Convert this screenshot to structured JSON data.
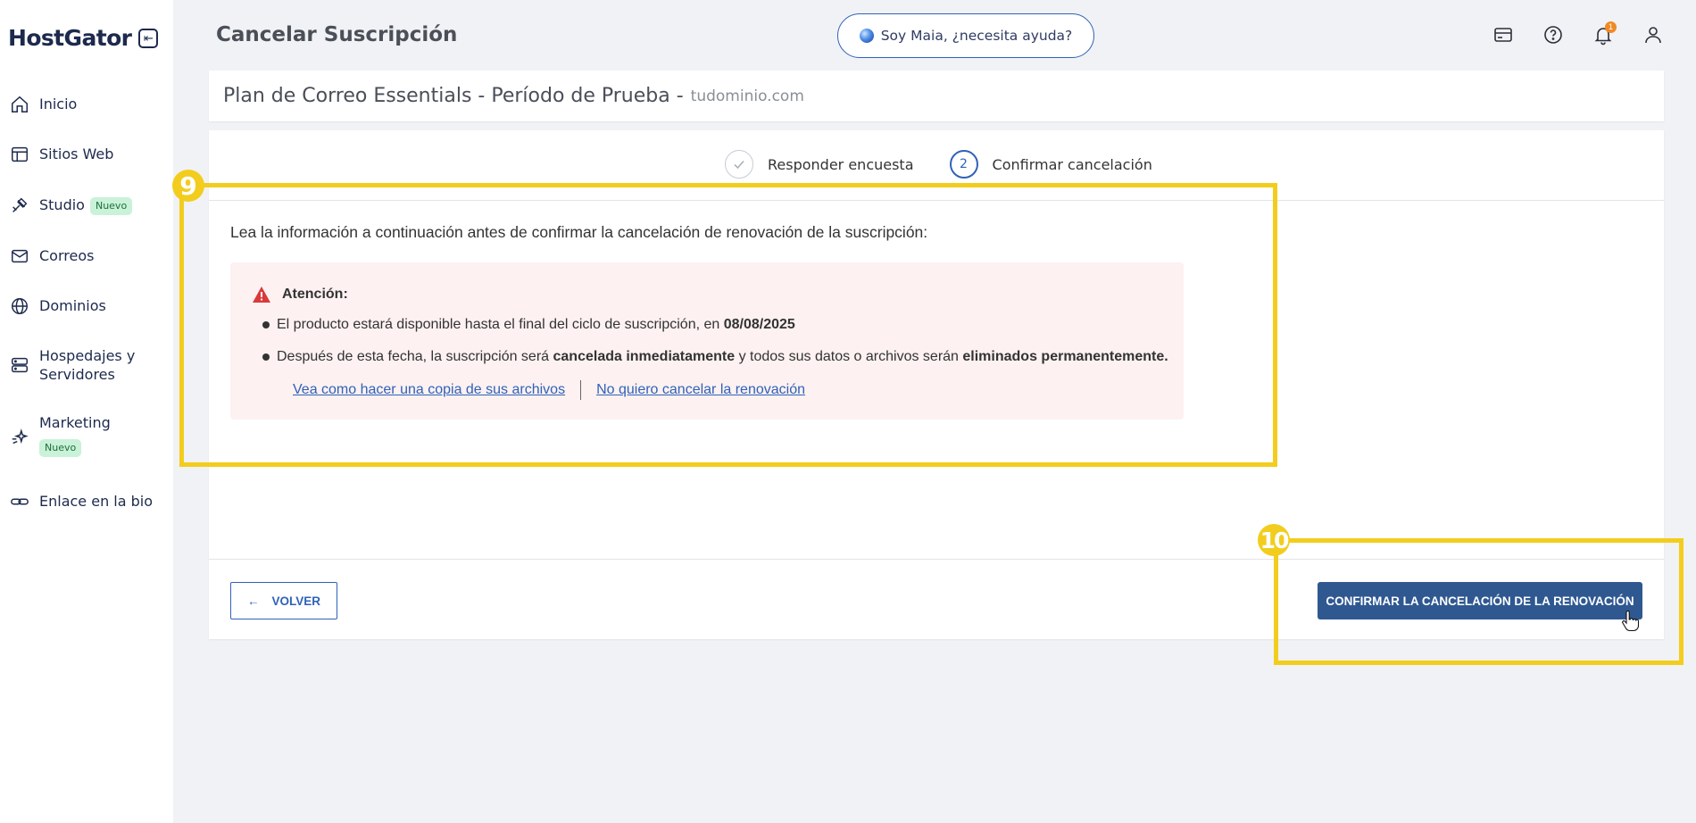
{
  "sidebar": {
    "brand": "HostGator",
    "items": [
      {
        "label": "Inicio",
        "icon": "home-icon"
      },
      {
        "label": "Sitios Web",
        "icon": "layout-icon"
      },
      {
        "label": "Studio",
        "badge": "Nuevo",
        "icon": "studio-icon"
      },
      {
        "label": "Correos",
        "icon": "mail-icon"
      },
      {
        "label": "Dominios",
        "icon": "globe-icon"
      },
      {
        "label": "Hospedajes y Servidores",
        "icon": "server-icon"
      },
      {
        "label": "Marketing",
        "badge": "Nuevo",
        "icon": "sparkle-icon"
      },
      {
        "label": "Enlace en la bio",
        "icon": "link-icon"
      }
    ]
  },
  "header": {
    "title": "Cancelar Suscripción",
    "assistant_label": "Soy Maia, ¿necesita ayuda?",
    "notification_count": "1"
  },
  "plan": {
    "name": "Plan de Correo Essentials - Período de Prueba -",
    "domain": "tudominio.com"
  },
  "stepper": {
    "step1_label": "Responder encuesta",
    "step2_number": "2",
    "step2_label": "Confirmar cancelación"
  },
  "main": {
    "intro": "Lea la información a continuación antes de confirmar la cancelación de renovación de la suscripción:",
    "alert_title": "Atención:",
    "bullet1_text": "El producto estará disponible hasta el final del ciclo de suscripción, en ",
    "bullet1_date": "08/08/2025",
    "bullet2_part1": "Después de esta fecha, la suscripción será ",
    "bullet2_bold1": "cancelada inmediatamente",
    "bullet2_part2": " y todos sus datos o archivos serán ",
    "bullet2_bold2": "eliminados permanentemente.",
    "link_backup": "Vea como hacer una copia de sus archivos",
    "link_keep": "No quiero cancelar la renovación"
  },
  "footer": {
    "back_label": "VOLVER",
    "confirm_label": "CONFIRMAR LA CANCELACIÓN DE LA RENOVACIÓN"
  },
  "annotations": {
    "marker9": "9",
    "marker10": "10",
    "color": "#f2cd1d"
  },
  "colors": {
    "primary": "#2f5891",
    "link": "#2f62b8",
    "alert_bg": "#fdf1f1",
    "badge_bg": "#c9f2d8"
  }
}
